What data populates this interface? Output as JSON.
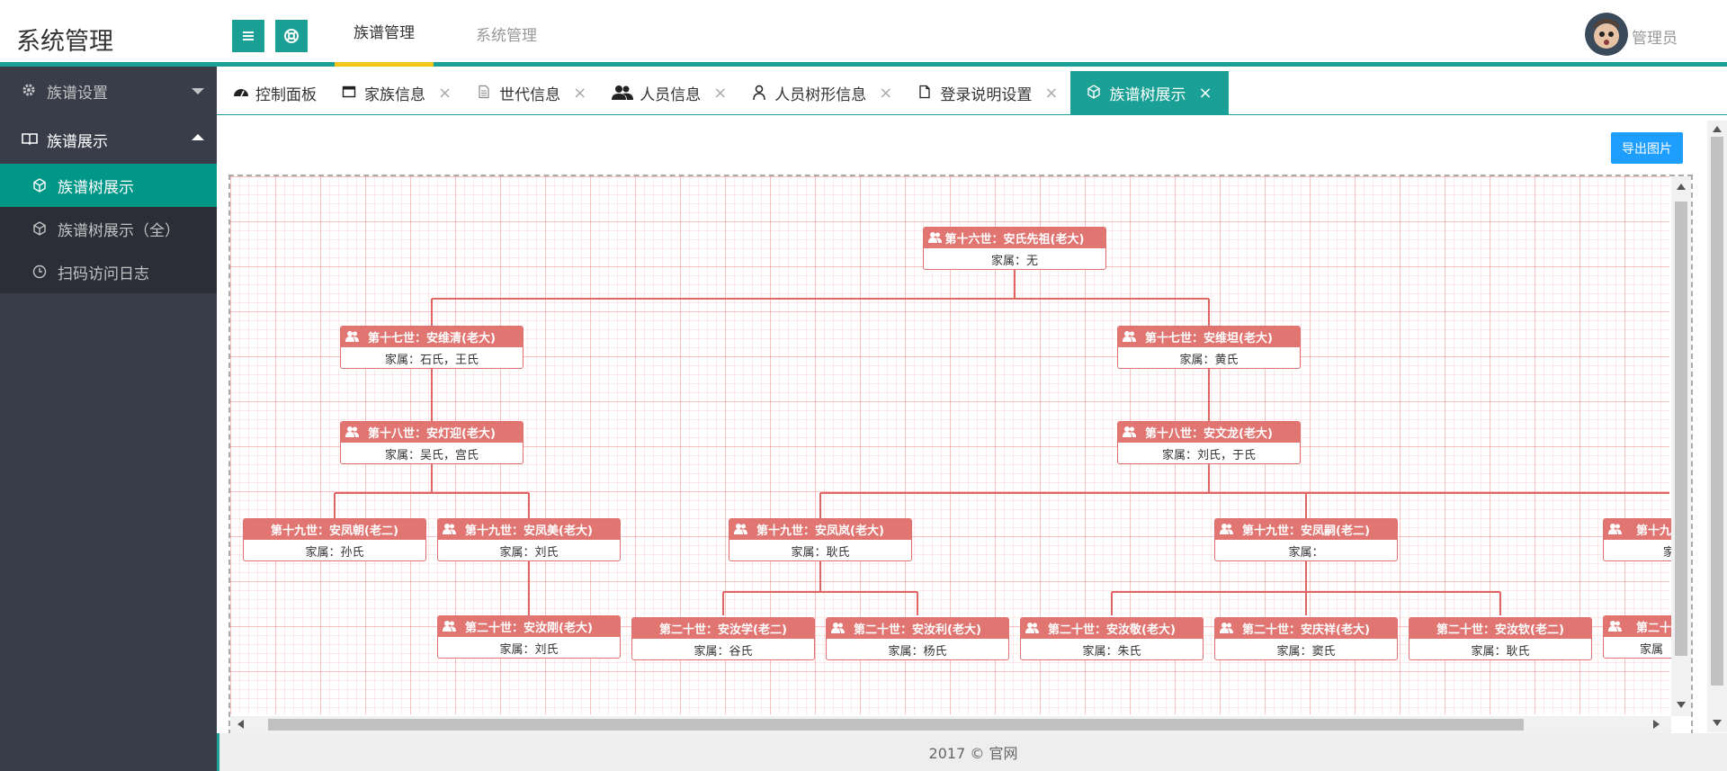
{
  "header": {
    "logo": "系统管理",
    "nav": [
      {
        "label": "族谱管理",
        "active": true
      },
      {
        "label": "系统管理",
        "active": false
      }
    ],
    "username": "管理员"
  },
  "sidebar": {
    "groups": [
      {
        "label": "族谱设置",
        "icon": "gear-icon",
        "open": false
      },
      {
        "label": "族谱展示",
        "icon": "book-icon",
        "open": true,
        "items": [
          {
            "label": "族谱树展示",
            "icon": "cube-icon",
            "active": true
          },
          {
            "label": "族谱树展示（全）",
            "icon": "cube-icon",
            "active": false
          },
          {
            "label": "扫码访问日志",
            "icon": "clock-icon",
            "active": false
          }
        ]
      }
    ]
  },
  "tabs": [
    {
      "label": "控制面板",
      "icon": "dashboard-icon",
      "closable": false
    },
    {
      "label": "家族信息",
      "icon": "window-icon",
      "closable": true
    },
    {
      "label": "世代信息",
      "icon": "document-icon",
      "closable": true
    },
    {
      "label": "人员信息",
      "icon": "users-icon",
      "closable": true
    },
    {
      "label": "人员树形信息",
      "icon": "user-icon",
      "closable": true
    },
    {
      "label": "登录说明设置",
      "icon": "file-icon",
      "closable": true
    },
    {
      "label": "族谱树展示",
      "icon": "cube-icon",
      "closable": true,
      "active": true
    }
  ],
  "content": {
    "export_label": "导出图片"
  },
  "tree": {
    "nodes": [
      {
        "id": "n16",
        "title": "第十六世：安氏先祖(老大)",
        "family": "家属：无"
      },
      {
        "id": "n17a",
        "title": "第十七世：安维清(老大)",
        "family": "家属：石氏，王氏"
      },
      {
        "id": "n17b",
        "title": "第十七世：安维坦(老大)",
        "family": "家属：黄氏"
      },
      {
        "id": "n18a",
        "title": "第十八世：安灯迎(老大)",
        "family": "家属：吴氏，宫氏"
      },
      {
        "id": "n18b",
        "title": "第十八世：安文龙(老大)",
        "family": "家属：刘氏，于氏"
      },
      {
        "id": "n19a",
        "title": "第十九世：安凤朝(老二)",
        "family": "家属：孙氏"
      },
      {
        "id": "n19b",
        "title": "第十九世：安凤美(老大)",
        "family": "家属：刘氏"
      },
      {
        "id": "n19c",
        "title": "第十九世：安凤岚(老大)",
        "family": "家属：耿氏"
      },
      {
        "id": "n19d",
        "title": "第十九世：安凤嗣(老二)",
        "family": "家属："
      },
      {
        "id": "n19e",
        "title": "第十九",
        "family": "家"
      },
      {
        "id": "n20a",
        "title": "第二十世：安汝刚(老大)",
        "family": "家属：刘氏"
      },
      {
        "id": "n20b",
        "title": "第二十世：安汝学(老二)",
        "family": "家属：谷氏"
      },
      {
        "id": "n20c",
        "title": "第二十世：安汝利(老大)",
        "family": "家属：杨氏"
      },
      {
        "id": "n20d",
        "title": "第二十世：安汝敬(老大)",
        "family": "家属：朱氏"
      },
      {
        "id": "n20e",
        "title": "第二十世：安庆祥(老大)",
        "family": "家属：窦氏"
      },
      {
        "id": "n20f",
        "title": "第二十世：安汝钦(老二)",
        "family": "家属：耿氏"
      },
      {
        "id": "n20g",
        "title": "第二十",
        "family": "家属"
      }
    ]
  },
  "footer": {
    "text": "2017 ©  官网"
  }
}
